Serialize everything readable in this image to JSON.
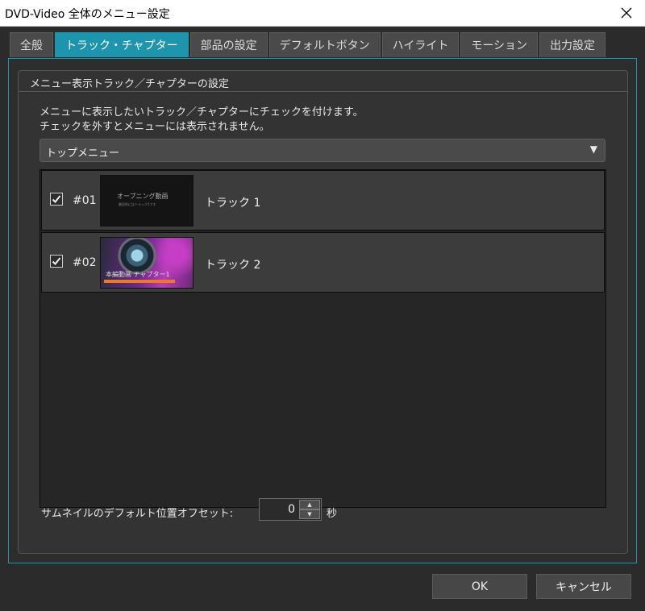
{
  "window": {
    "title": "DVD-Video 全体のメニュー設定",
    "close_icon": "close-icon"
  },
  "tabs": [
    {
      "label": "全般"
    },
    {
      "label": "トラック・チャプター",
      "active": true
    },
    {
      "label": "部品の設定"
    },
    {
      "label": "デフォルトボタン"
    },
    {
      "label": "ハイライト"
    },
    {
      "label": "モーション"
    },
    {
      "label": "出力設定"
    }
  ],
  "colors": {
    "accent": "#1f94ad",
    "background": "#2b2b2b"
  },
  "group": {
    "title": "メニュー表示トラック／チャプターの設定",
    "desc_line1": "メニューに表示したいトラック／チャプターにチェックを付けます。",
    "desc_line2": "チェックを外すとメニューには表示されません。"
  },
  "menu_select": {
    "value": "トップメニュー",
    "icon": "chevron-down-icon"
  },
  "tracks": [
    {
      "checked": true,
      "number": "#01",
      "name": "トラック 1",
      "thumb_title": "オープニング動画",
      "thumb_sub": "最初的にはトラック1です"
    },
    {
      "checked": true,
      "number": "#02",
      "name": "トラック 2",
      "thumb_title": "本編動画 チャプター1"
    }
  ],
  "offset": {
    "label": "サムネイルのデフォルト位置オフセット:",
    "value": "0",
    "unit": "秒"
  },
  "buttons": {
    "ok": "OK",
    "cancel": "キャンセル"
  }
}
